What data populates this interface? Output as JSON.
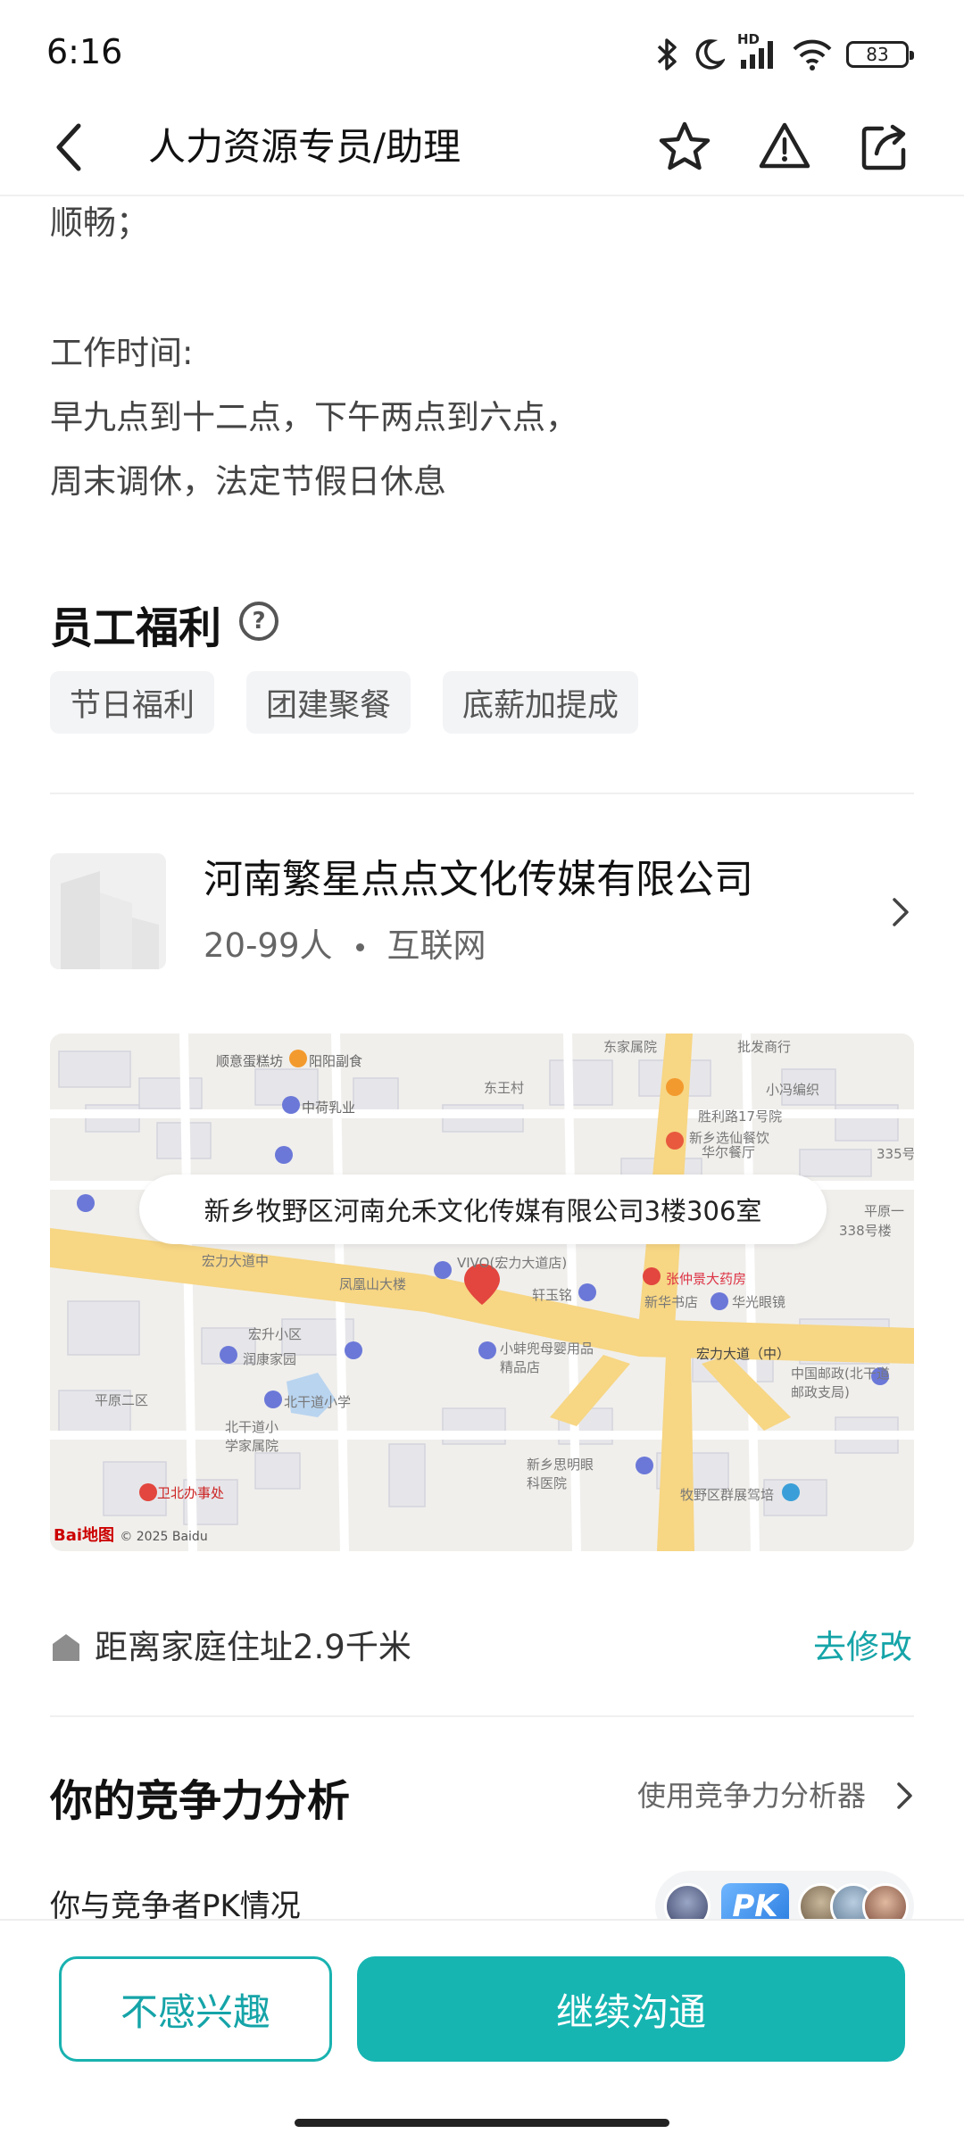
{
  "status_bar": {
    "time": "6:16",
    "battery": "83",
    "network": "HD",
    "icons": [
      "bluetooth-icon",
      "moon-icon",
      "signal-icon",
      "wifi-icon",
      "battery-icon"
    ]
  },
  "nav": {
    "title": "人力资源专员/助理",
    "actions": [
      "star-icon",
      "report-icon",
      "share-icon"
    ]
  },
  "description": {
    "lines": [
      "顺畅；",
      "",
      "工作时间:",
      "早九点到十二点，下午两点到六点，",
      "周末调休，法定节假日休息"
    ]
  },
  "benefits": {
    "title": "员工福利",
    "help_icon": "?",
    "tags": [
      "节日福利",
      "团建聚餐",
      "底薪加提成"
    ]
  },
  "company": {
    "name": "河南繁星点点文化传媒有限公司",
    "size": "20-99人",
    "industry": "互联网"
  },
  "map": {
    "address": "新乡牧野区河南允禾文化传媒有限公司3楼306室",
    "brand": "Bai",
    "brand_suffix": "地图",
    "copyright": "© 2025 Baidu",
    "labels": [
      "顺意蛋糕坊",
      "阳阳副食",
      "东王村",
      "东家属院",
      "批发商行",
      "小冯编织",
      "中荷乳业",
      "胜利路17号院",
      "新乡选仙餐饮",
      "华尔餐厅",
      "宏力大道中",
      "凤凰山大楼",
      "VIVO(宏力大道店)",
      "轩玉铭",
      "张仲景大药房",
      "新华书店",
      "华光眼镜",
      "宏升小区",
      "润康家园",
      "北干道小学",
      "小蚌兜母婴用品精品店",
      "宏力大道（中）",
      "中国邮政(北干道邮政支局)",
      "平原二区",
      "北干道小学家属院",
      "新乡思明眼科医院",
      "牧野区群展驾培",
      "卫北办事处",
      "平原一",
      "338号楼",
      "335号"
    ]
  },
  "distance": {
    "text": "距离家庭住址2.9千米",
    "edit": "去修改"
  },
  "competitiveness": {
    "title": "你的竞争力分析",
    "link": "使用竞争力分析器",
    "pk_text": "你与竞争者PK情况",
    "pk_badge": "PK"
  },
  "bottom": {
    "not_interested": "不感兴趣",
    "continue": "继续沟通"
  },
  "colors": {
    "accent": "#16b5b2",
    "accent_text": "#15a4a8",
    "road": "#f6d27a",
    "map_bg": "#f0efec"
  }
}
